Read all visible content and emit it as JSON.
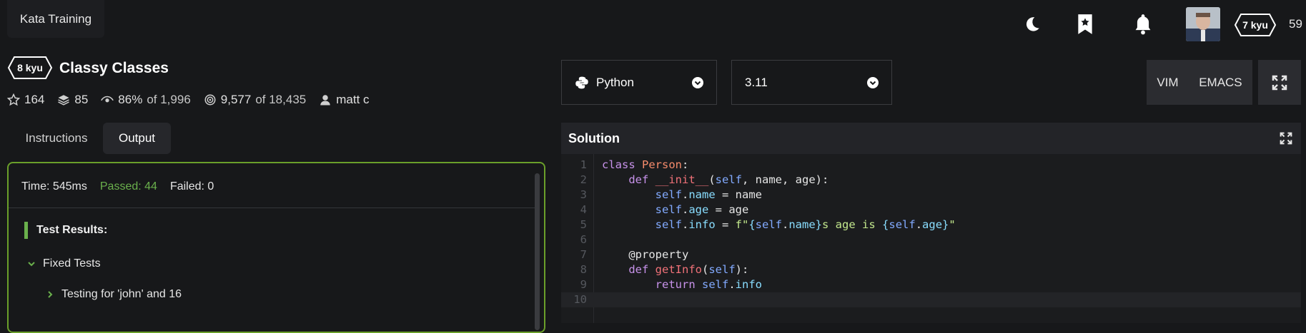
{
  "topbar": {
    "section_label": "Kata Training",
    "user_rank": "7 kyu",
    "honor": "59"
  },
  "kata": {
    "rank": "8 kyu",
    "title": "Classy Classes",
    "stats": {
      "stars": "164",
      "collections": "85",
      "satisfaction": "86%",
      "satisfaction_of": "of 1,996",
      "completed": "9,577",
      "completed_of": "of 18,435",
      "author": "matt c"
    }
  },
  "tabs": {
    "instructions": "Instructions",
    "output": "Output"
  },
  "output": {
    "time": "Time: 545ms",
    "passed": "Passed: 44",
    "failed": "Failed: 0",
    "results_heading": "Test Results:",
    "group_label": "Fixed Tests",
    "test_label": "Testing for 'john' and 16"
  },
  "selectors": {
    "language": "Python",
    "version": "3.11",
    "mode_vim": "VIM",
    "mode_emacs": "EMACS"
  },
  "solution": {
    "title": "Solution",
    "line_numbers": [
      "1",
      "2",
      "3",
      "4",
      "5",
      "6",
      "7",
      "8",
      "9",
      "10"
    ]
  },
  "colors": {
    "accent_green": "#6ab04c",
    "panel_border": "#6a9f2a",
    "background": "#17181a"
  },
  "icons": [
    "moon-icon",
    "bookmark-star-icon",
    "bell-icon",
    "star-icon",
    "layers-icon",
    "eye-icon",
    "target-icon",
    "user-icon",
    "python-icon",
    "chevron-down-icon",
    "fullscreen-icon"
  ]
}
